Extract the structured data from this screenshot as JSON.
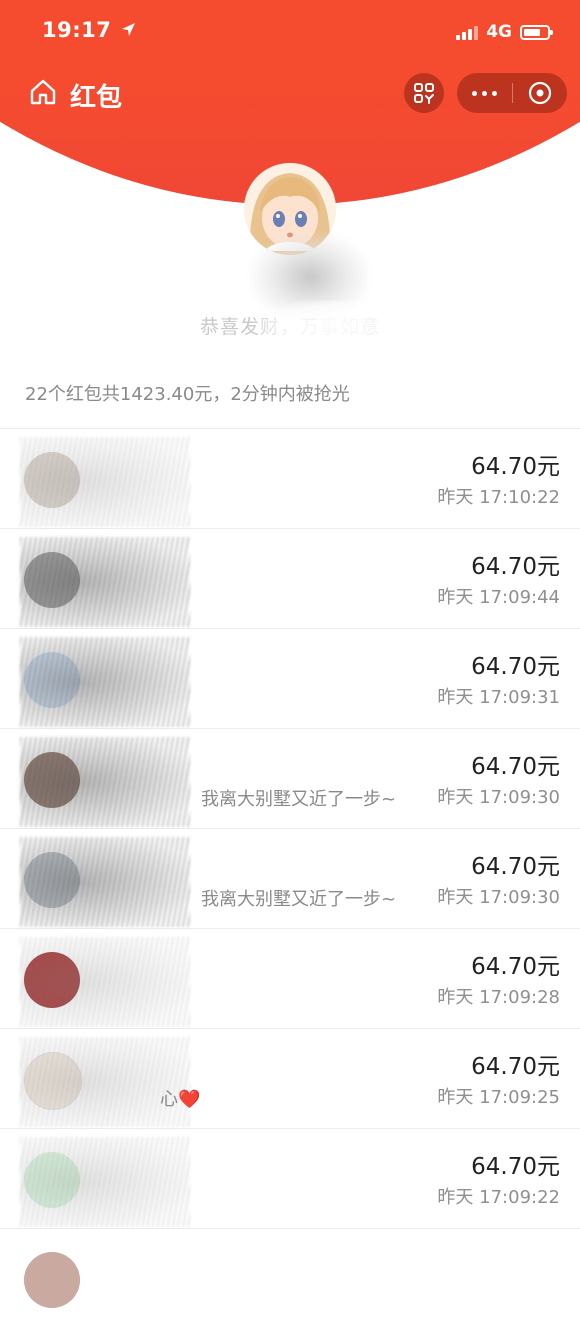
{
  "status_bar": {
    "time": "19:17",
    "network": "4G"
  },
  "nav": {
    "title": "红包"
  },
  "sender": {
    "blessing": "恭喜发财，万事如意"
  },
  "summary": "22个红包共1423.40元，2分钟内被抢光",
  "records": [
    {
      "amount": "64.70元",
      "time": "昨天 17:10:22",
      "message": ""
    },
    {
      "amount": "64.70元",
      "time": "昨天 17:09:44",
      "message": ""
    },
    {
      "amount": "64.70元",
      "time": "昨天 17:09:31",
      "message": ""
    },
    {
      "amount": "64.70元",
      "time": "昨天 17:09:30",
      "message": "我离大别墅又近了一步~"
    },
    {
      "amount": "64.70元",
      "time": "昨天 17:09:30",
      "message": "我离大别墅又近了一步~"
    },
    {
      "amount": "64.70元",
      "time": "昨天 17:09:28",
      "message": ""
    },
    {
      "amount": "64.70元",
      "time": "昨天 17:09:25",
      "message": "心❤️"
    },
    {
      "amount": "64.70元",
      "time": "昨天 17:09:22",
      "message": ""
    }
  ],
  "colors": {
    "header": "#f84f2c",
    "amount_text": "#222222",
    "secondary_text": "#8a8a8a"
  }
}
